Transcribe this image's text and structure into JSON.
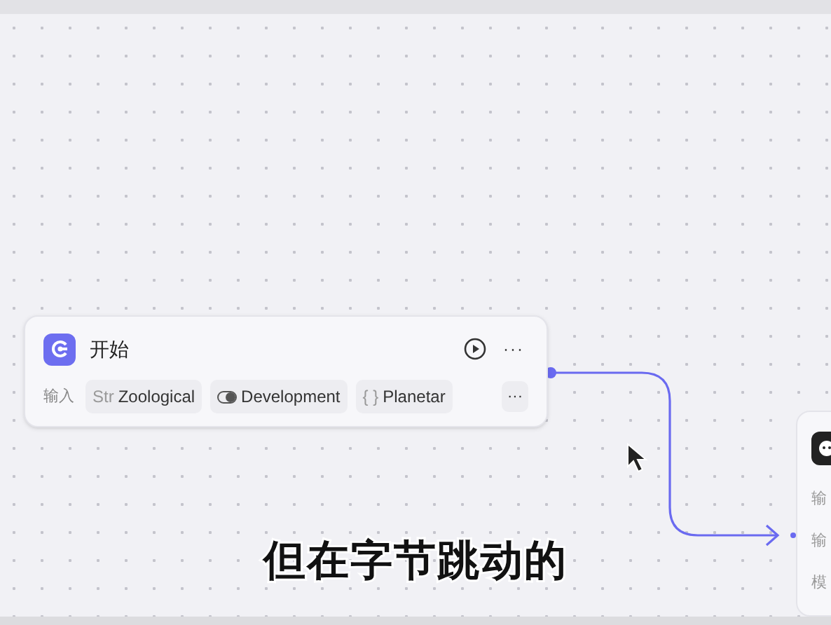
{
  "start_node": {
    "title": "开始",
    "input_label": "输入",
    "inputs": [
      {
        "kind": "string",
        "type_label": "Str",
        "name": "Zoological"
      },
      {
        "kind": "boolean",
        "name": "Development"
      },
      {
        "kind": "object",
        "type_label": "{ }",
        "name": "Planetar"
      }
    ],
    "more_label": "···",
    "menu_label": "···"
  },
  "next_node": {
    "rows": [
      "输",
      "输",
      "模"
    ]
  },
  "subtitle": "但在字节跳动的"
}
